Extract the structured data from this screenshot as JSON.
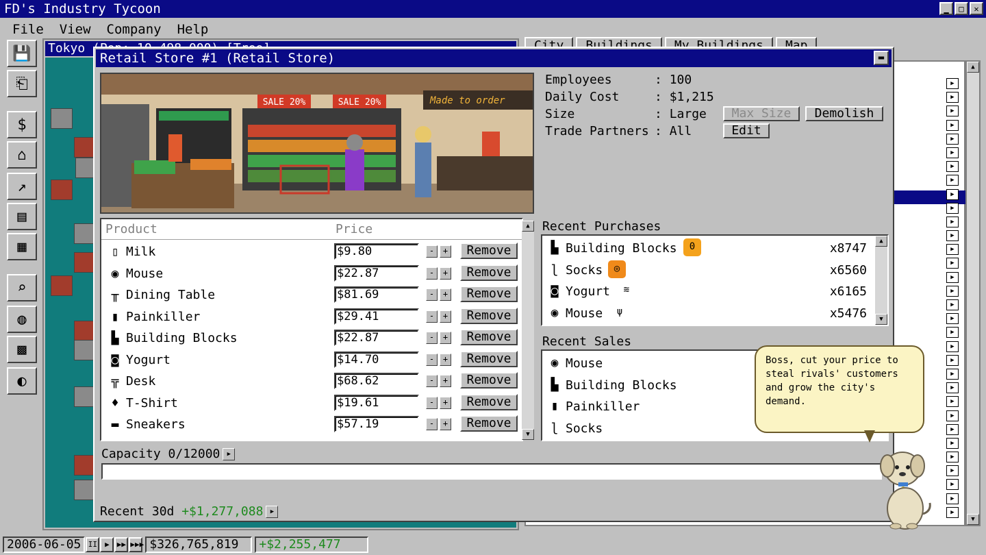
{
  "app": {
    "title": "FD's Industry Tycoon"
  },
  "menu": [
    "File",
    "View",
    "Company",
    "Help"
  ],
  "map_window": {
    "title": "Tokyo (Pop: 10,498,000) [Tree]"
  },
  "right_tabs": [
    "City",
    "Buildings",
    "My Buildings",
    "Map"
  ],
  "retail": {
    "title": "Retail Store #1 (Retail Store)",
    "info": [
      {
        "label": "Employees",
        "sep": ":",
        "value": "100"
      },
      {
        "label": "Daily Cost",
        "sep": ":",
        "value": "$1,215"
      },
      {
        "label": "Size",
        "sep": ":",
        "value": "Large"
      },
      {
        "label": "Trade Partners",
        "sep": ":",
        "value": "All"
      }
    ],
    "buttons": {
      "max_size": "Max Size",
      "demolish": "Demolish",
      "edit": "Edit"
    },
    "scene_signs": {
      "sale1": "SALE 20%",
      "sale2": "SALE 20%",
      "made": "Made to order"
    },
    "product_header": {
      "product": "Product",
      "price": "Price"
    },
    "products": [
      {
        "name": "Milk",
        "price": "$9.80",
        "icon": "milk-icon",
        "glyph": "▯"
      },
      {
        "name": "Mouse",
        "price": "$22.87",
        "icon": "mouse-icon",
        "glyph": "◉"
      },
      {
        "name": "Dining Table",
        "price": "$81.69",
        "icon": "table-icon",
        "glyph": "╥"
      },
      {
        "name": "Painkiller",
        "price": "$29.41",
        "icon": "pill-bottle-icon",
        "glyph": "▮"
      },
      {
        "name": "Building Blocks",
        "price": "$22.87",
        "icon": "blocks-icon",
        "glyph": "▙"
      },
      {
        "name": "Yogurt",
        "price": "$14.70",
        "icon": "yogurt-icon",
        "glyph": "◙"
      },
      {
        "name": "Desk",
        "price": "$68.62",
        "icon": "desk-icon",
        "glyph": "╦"
      },
      {
        "name": "T-Shirt",
        "price": "$19.61",
        "icon": "tshirt-icon",
        "glyph": "♦"
      },
      {
        "name": "Sneakers",
        "price": "$57.19",
        "icon": "sneaker-icon",
        "glyph": "▬"
      }
    ],
    "remove_label": "Remove",
    "minus": "-",
    "plus": "+",
    "recent_purchases_title": "Recent Purchases",
    "recent_purchases": [
      {
        "name": "Building Blocks",
        "qty": "x8747",
        "icon": "blocks-icon",
        "glyph": "▙",
        "partner_icon": "orange-zero-logo-icon",
        "partner_glyph": "0",
        "partner_color": "#f4a21c"
      },
      {
        "name": "Socks",
        "qty": "x6560",
        "icon": "sock-icon",
        "glyph": "ɭ",
        "partner_icon": "orange-swirl-logo-icon",
        "partner_glyph": "◎",
        "partner_color": "#f08a1a"
      },
      {
        "name": "Yogurt",
        "qty": "x6165",
        "icon": "yogurt-icon",
        "glyph": "◙",
        "partner_icon": "blue-wave-logo-icon",
        "partner_glyph": "≋",
        "partner_color": "#ffffff"
      },
      {
        "name": "Mouse",
        "qty": "x5476",
        "icon": "mouse-icon",
        "glyph": "◉",
        "partner_icon": "green-cactus-logo-icon",
        "partner_glyph": "ψ",
        "partner_color": "#ffffff"
      }
    ],
    "recent_sales_title": "Recent Sales",
    "recent_sales": [
      {
        "name": "Mouse",
        "icon": "mouse-icon",
        "glyph": "◉"
      },
      {
        "name": "Building Blocks",
        "icon": "blocks-icon",
        "glyph": "▙"
      },
      {
        "name": "Painkiller",
        "icon": "pill-bottle-icon",
        "glyph": "▮"
      },
      {
        "name": "Socks",
        "icon": "sock-icon",
        "glyph": "ɭ"
      }
    ],
    "capacity": "Capacity 0/12000",
    "recent30_label": "Recent 30d",
    "recent30_value": "+$1,277,088"
  },
  "advisor": {
    "text": "Boss, cut your price to steal rivals' customers and grow the city's demand."
  },
  "status": {
    "date": "2006-06-05",
    "cash": "$326,765,819",
    "delta": "+$2,255,477",
    "speed_glyphs": [
      "II",
      "▶",
      "▶▶",
      "▶▶▶"
    ]
  },
  "colors": {
    "title_blue": "#0a0a86",
    "map_teal": "#117c7c",
    "positive_green": "#1e8a1e",
    "panel_gray": "#c0c0c0"
  }
}
